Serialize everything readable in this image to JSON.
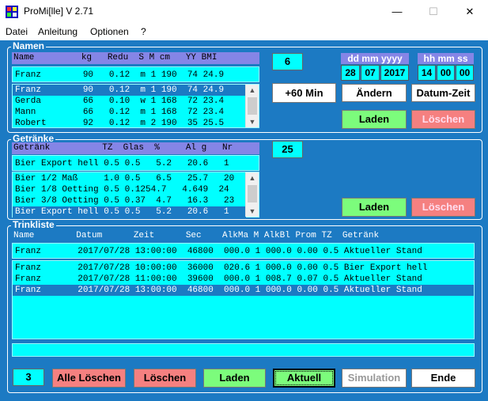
{
  "window": {
    "title": "ProMi[lle] V 2.71",
    "minimize": "—",
    "maximize": "☐",
    "close": "✕"
  },
  "menu": [
    "Datei",
    "Anleitung",
    "Optionen",
    "?"
  ],
  "namen": {
    "title": "Namen",
    "header": "Name         kg   Redu  S M cm   YY BMI",
    "current": "Franz        90   0.12  m 1 190  74 24.9",
    "rows": [
      "Franz        90   0.12  m 1 190  74 24.9",
      "Gerda        66   0.10  w 1 168  72 23.4",
      "Mann         66   0.12  m 1 168  72 23.4",
      "Robert       92   0.12  m 2 190  35 25.5"
    ],
    "selected_index": 0,
    "count": "6",
    "plus60": "+60 Min",
    "aendern": "Ändern",
    "datum_zeit": "Datum-Zeit",
    "laden": "Laden",
    "loeschen": "Löschen"
  },
  "datetime": {
    "date_label": "dd mm yyyy",
    "time_label": "hh mm ss",
    "dd": "28",
    "mm": "07",
    "yyyy": "2017",
    "hh": "14",
    "min": "00",
    "ss": "00"
  },
  "getraenke": {
    "title": "Getränke",
    "header": "Getränk          TZ  Glas  %     Al g   Nr",
    "current": "Bier Export hell 0.5 0.5   5.2   20.6   1",
    "rows": [
      "Bier 1/2 Maß     1.0 0.5   6.5   25.7   20",
      "Bier 1/8 Oetting 0.5 0.1254.7   4.649  24",
      "Bier 3/8 Oetting 0.5 0.37  4.7   16.3   23",
      "Bier Export hell 0.5 0.5   5.2   20.6   1"
    ],
    "selected_index": 3,
    "count": "25",
    "laden": "Laden",
    "loeschen": "Löschen"
  },
  "trinkliste": {
    "title": "Trinkliste",
    "header": "Name        Datum      Zeit      Sec    AlkMa M AlkBl Prom TZ  Getränk",
    "current": "Franz       2017/07/28 13:00:00  46800  000.0 1 000.0 0.00 0.5 Aktueller Stand",
    "rows": [
      "Franz       2017/07/28 10:00:00  36000  020.6 1 000.0 0.00 0.5 Bier Export hell",
      "Franz       2017/07/28 11:00:00  39600  000.0 1 008.7 0.07 0.5 Aktueller Stand",
      "Franz       2017/07/28 13:00:00  46800  000.0 1 000.0 0.00 0.5 Aktueller Stand"
    ],
    "selected_index": 2,
    "status": ""
  },
  "bottom": {
    "count": "3",
    "alle_loeschen": "Alle Löschen",
    "loeschen": "Löschen",
    "laden": "Laden",
    "aktuell": "Aktuell",
    "simulation": "Simulation",
    "ende": "Ende"
  },
  "colors": {
    "accent": "#1c7ac3",
    "cyan": "#00ffff",
    "header": "#8585e6",
    "green": "#7cfc7c",
    "red": "#f58080"
  }
}
